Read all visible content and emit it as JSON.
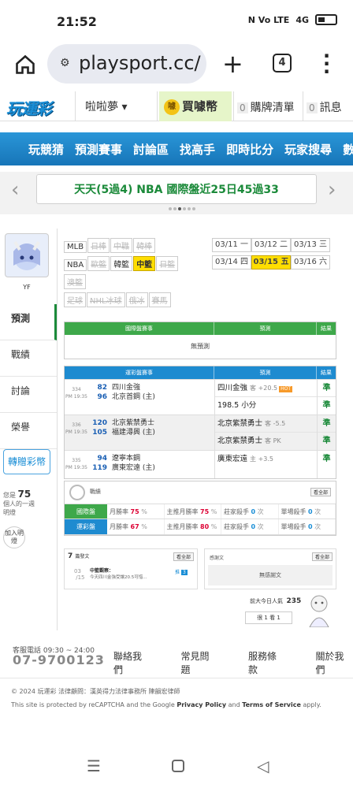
{
  "status": {
    "time": "21:52",
    "network": "4G",
    "sim": "N  Vo LTE"
  },
  "browser": {
    "url": "playsport.cc/",
    "tab_count": "4"
  },
  "header": {
    "logo": "玩運彩",
    "user_menu": "啦啦夢 ▾",
    "buy_coins": "買噱幣",
    "coin_icon": "噱",
    "cart_count": "0",
    "cart": "購牌清單",
    "msg_count": "0",
    "messages": "訊息"
  },
  "nav": [
    "玩競猜",
    "預測賽事",
    "討論區",
    "找高手",
    "即時比分",
    "玩家搜尋",
    "數據"
  ],
  "banner": {
    "text": "天天(5過4) NBA 國際盤近25日45過33"
  },
  "profile": {
    "name": "YF"
  },
  "sidebar": {
    "items": [
      "預測",
      "戰績",
      "討論",
      "榮譽"
    ],
    "gift_button": "轉贈彩幣",
    "hint_prefix": "您是",
    "hint_count": "75",
    "hint_suffix": "個人的一週明燈",
    "add_friend": "加入明燈"
  },
  "leagues": [
    {
      "label": "MLB",
      "state": "normal"
    },
    {
      "label": "日棒",
      "state": "disabled"
    },
    {
      "label": "中職",
      "state": "disabled"
    },
    {
      "label": "韓棒",
      "state": "disabled"
    },
    {
      "label": "NBA",
      "state": "normal"
    },
    {
      "label": "歐籃",
      "state": "disabled"
    },
    {
      "label": "韓籃",
      "state": "normal"
    },
    {
      "label": "中籃",
      "state": "selected"
    },
    {
      "label": "日籃",
      "state": "disabled"
    },
    {
      "label": "澳籃",
      "state": "disabled"
    },
    {
      "label": "足球",
      "state": "disabled"
    },
    {
      "label": "NHL冰球",
      "state": "disabled"
    },
    {
      "label": "俄冰",
      "state": "disabled"
    },
    {
      "label": "賽馬",
      "state": "disabled"
    }
  ],
  "dates": [
    {
      "label": "03/11 一",
      "selected": false
    },
    {
      "label": "03/12 二",
      "selected": false
    },
    {
      "label": "03/13 三",
      "selected": false
    },
    {
      "label": "03/14 四",
      "selected": false
    },
    {
      "label": "03/15 五",
      "selected": true
    },
    {
      "label": "03/16 六",
      "selected": false
    }
  ],
  "intl_table": {
    "headers": [
      "國際盤賽事",
      "預測",
      "結果"
    ],
    "empty": "無預測"
  },
  "lottery_table": {
    "headers": [
      "運彩盤賽事",
      "預測",
      "結果"
    ],
    "games": [
      {
        "num": "334",
        "time": "PM 19:35",
        "teams": [
          {
            "score": "82",
            "name": "四川金強"
          },
          {
            "score": "96",
            "name": "北京首鋼 (主)"
          }
        ],
        "picks": [
          {
            "main": "四川金強",
            "extra": "客 +20.5",
            "hot": "HOT"
          },
          {
            "main": "198.5 小分",
            "extra": ""
          }
        ],
        "results": [
          "準",
          "準"
        ]
      },
      {
        "num": "336",
        "time": "PM 19:35",
        "teams": [
          {
            "score": "120",
            "name": "北京紫禁勇士"
          },
          {
            "score": "105",
            "name": "福建潯興 (主)"
          }
        ],
        "picks": [
          {
            "main": "北京紫禁勇士",
            "extra": "客 -5.5"
          },
          {
            "main": "北京紫禁勇士",
            "extra": "客 PK"
          }
        ],
        "results": [
          "準",
          "準"
        ]
      },
      {
        "num": "335",
        "time": "PM 19:35",
        "teams": [
          {
            "score": "94",
            "name": "遼寧本鋼"
          },
          {
            "score": "119",
            "name": "廣東宏遠 (主)"
          }
        ],
        "picks": [
          {
            "main": "廣東宏遠",
            "extra": "主 +3.5"
          }
        ],
        "results": [
          "準"
        ]
      }
    ]
  },
  "stats": {
    "title": "戰績",
    "view_all": "看全部",
    "rows": [
      {
        "tag": "國際盤",
        "color": "#3ea84a",
        "cells": [
          {
            "label": "月勝率",
            "value": "75",
            "unit": "%"
          },
          {
            "label": "主推月勝率",
            "value": "75",
            "unit": "%"
          },
          {
            "label": "莊家殺手",
            "value": "0",
            "unit": "次"
          },
          {
            "label": "單場殺手",
            "value": "0",
            "unit": "次"
          }
        ]
      },
      {
        "tag": "運彩盤",
        "color": "#1e8bd0",
        "cells": [
          {
            "label": "月勝率",
            "value": "67",
            "unit": "%"
          },
          {
            "label": "主推月勝率",
            "value": "80",
            "unit": "%"
          },
          {
            "label": "莊家殺手",
            "value": "0",
            "unit": "次"
          },
          {
            "label": "單場殺手",
            "value": "0",
            "unit": "次"
          }
        ]
      }
    ]
  },
  "posts": {
    "count": "7",
    "title": "篇發文",
    "view_all": "看全部",
    "date_day": "03",
    "date_num": "15",
    "post_title": "中籃觀察：",
    "post_excerpt": "今天四川金強受讓20.5可惜...",
    "replies_label": "推",
    "replies": "3"
  },
  "thanks": {
    "title": "感謝文",
    "view_all": "看全部",
    "empty": "無感謝文"
  },
  "popularity": {
    "label": "前大今日人氣",
    "value": "235",
    "visited": "很 1 看 1"
  },
  "footer": {
    "service_hours": "客服電話 09:30 ~ 24:00",
    "phone": "07-9700123",
    "links": [
      "聯絡我們",
      "常見問題",
      "服務條款",
      "關於我們"
    ],
    "copyright": "© 2024 玩運彩 法律顧問：漢英得力法律事務所 陳韻宏律師",
    "recaptcha_pre": "This site is protected by reCAPTCHA and the Google ",
    "privacy": "Privacy Policy",
    "and": " and ",
    "terms": "Terms of Service",
    "apply": " apply."
  }
}
